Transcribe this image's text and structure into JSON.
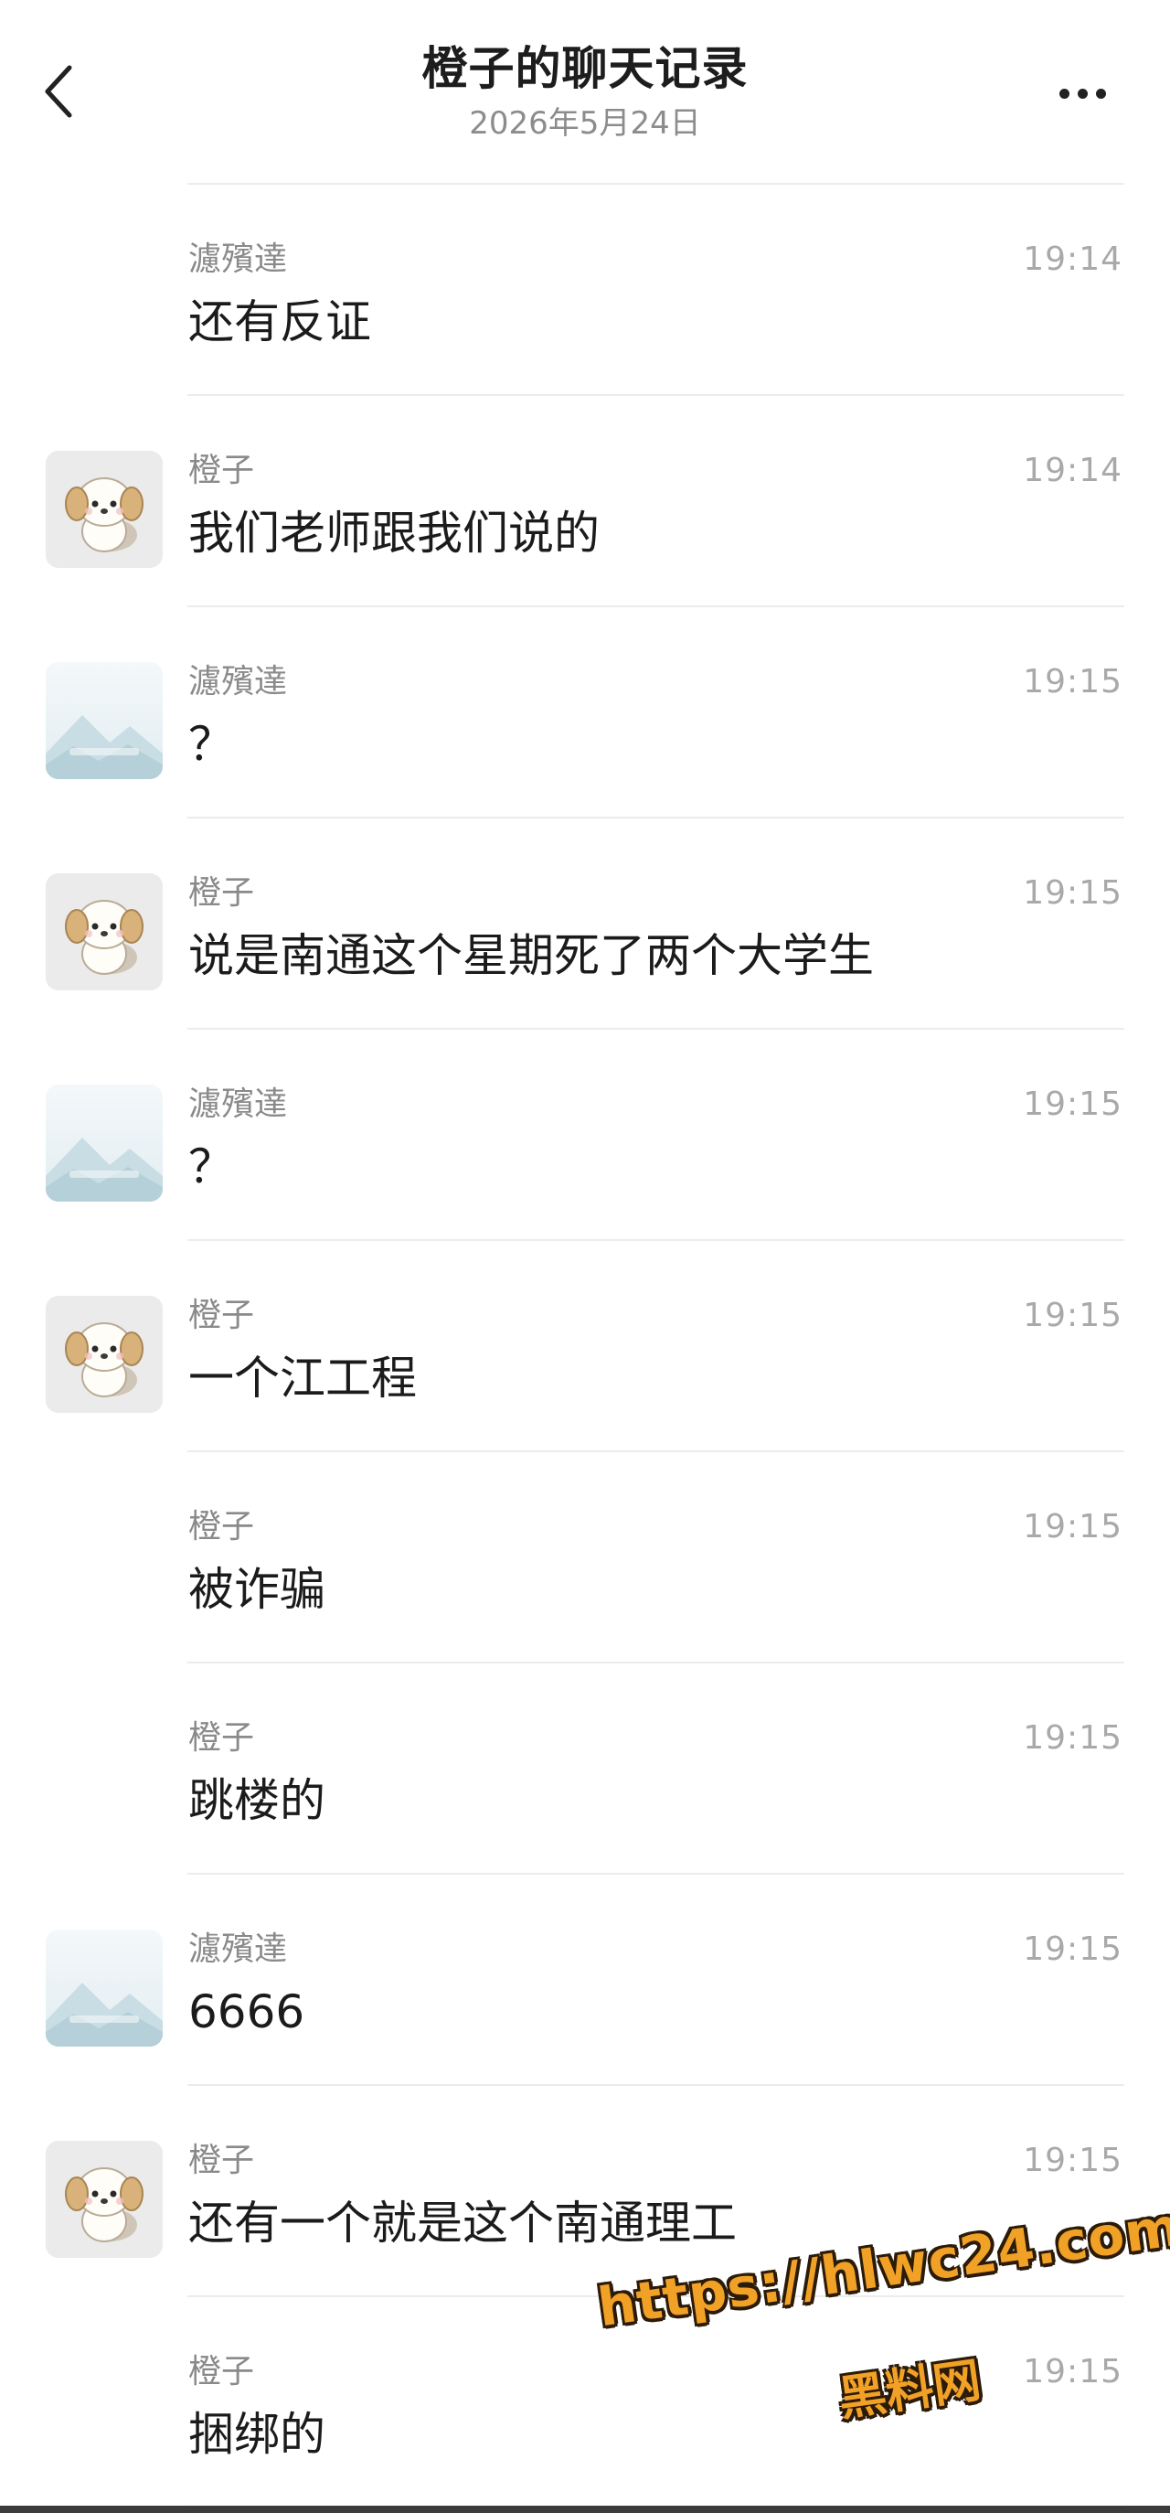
{
  "header": {
    "back_icon": "chevron-left-icon",
    "title": "橙子的聊天记录",
    "date": "2026年5月24日",
    "more_icon": "more-horizontal-icon"
  },
  "messages": [
    {
      "sender": "濾殯達",
      "time": "19:14",
      "text": "还有反证",
      "avatar": "none"
    },
    {
      "sender": "橙子",
      "time": "19:14",
      "text": "我们老师跟我们说的",
      "avatar": "dog"
    },
    {
      "sender": "濾殯達",
      "time": "19:15",
      "text": "？",
      "avatar": "scene"
    },
    {
      "sender": "橙子",
      "time": "19:15",
      "text": "说是南通这个星期死了两个大学生",
      "avatar": "dog"
    },
    {
      "sender": "濾殯達",
      "time": "19:15",
      "text": "？",
      "avatar": "scene"
    },
    {
      "sender": "橙子",
      "time": "19:15",
      "text": "一个江工程",
      "avatar": "dog"
    },
    {
      "sender": "橙子",
      "time": "19:15",
      "text": "被诈骗",
      "avatar": "none"
    },
    {
      "sender": "橙子",
      "time": "19:15",
      "text": "跳楼的",
      "avatar": "none"
    },
    {
      "sender": "濾殯達",
      "time": "19:15",
      "text": "6666",
      "avatar": "scene"
    },
    {
      "sender": "橙子",
      "time": "19:15",
      "text": "还有一个就是这个南通理工",
      "avatar": "dog"
    },
    {
      "sender": "橙子",
      "time": "19:15",
      "text": "捆绑的",
      "avatar": "none"
    }
  ],
  "watermark": {
    "url": "https://hlwc24.com",
    "name": "黑料网"
  },
  "colors": {
    "title": "#1d1d1d",
    "meta": "#8a8a8a",
    "time": "#a9a9a9",
    "divider": "#ececec",
    "watermark": "#f2a127"
  }
}
